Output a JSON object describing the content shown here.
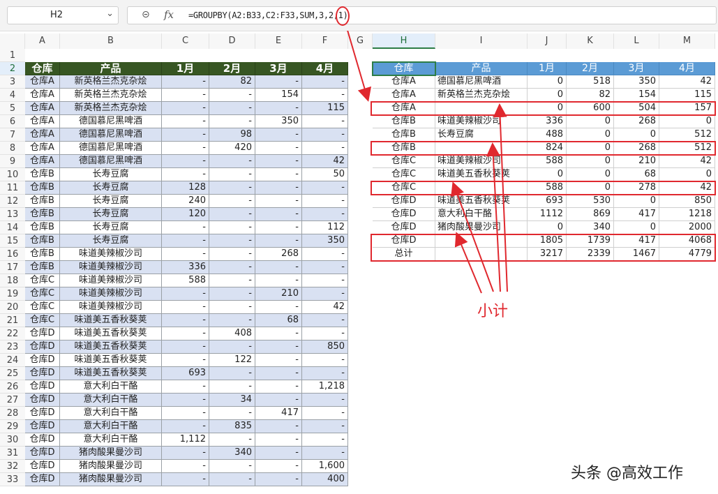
{
  "name_box": "H2",
  "formula_bar": {
    "zoom_icon": "zoom-icon",
    "fx_label": "fx",
    "formula": "=GROUPBY(A2:B33,C2:F33,SUM,3,2,1)"
  },
  "columns": [
    "A",
    "B",
    "C",
    "D",
    "E",
    "F",
    "G",
    "H",
    "I",
    "J",
    "K",
    "L",
    "M"
  ],
  "rows": [
    "1",
    "2",
    "3",
    "4",
    "5",
    "6",
    "7",
    "8",
    "9",
    "10",
    "11",
    "12",
    "13",
    "14",
    "15",
    "16",
    "17",
    "18",
    "19",
    "20",
    "21",
    "22",
    "23",
    "24",
    "25",
    "26",
    "27",
    "28",
    "29",
    "30",
    "31",
    "32",
    "33"
  ],
  "source_table": {
    "headers": [
      "仓库",
      "产品",
      "1月",
      "2月",
      "3月",
      "4月"
    ],
    "rows": [
      [
        "仓库A",
        "新英格兰杰克杂烩",
        "-",
        "82",
        "-",
        "-"
      ],
      [
        "仓库A",
        "新英格兰杰克杂烩",
        "-",
        "-",
        "154",
        "-"
      ],
      [
        "仓库A",
        "新英格兰杰克杂烩",
        "-",
        "-",
        "-",
        "115"
      ],
      [
        "仓库A",
        "德国慕尼黑啤酒",
        "-",
        "-",
        "350",
        "-"
      ],
      [
        "仓库A",
        "德国慕尼黑啤酒",
        "-",
        "98",
        "-",
        "-"
      ],
      [
        "仓库A",
        "德国慕尼黑啤酒",
        "-",
        "420",
        "-",
        "-"
      ],
      [
        "仓库A",
        "德国慕尼黑啤酒",
        "-",
        "-",
        "-",
        "42"
      ],
      [
        "仓库B",
        "长寿豆腐",
        "-",
        "-",
        "-",
        "50"
      ],
      [
        "仓库B",
        "长寿豆腐",
        "128",
        "-",
        "-",
        "-"
      ],
      [
        "仓库B",
        "长寿豆腐",
        "240",
        "-",
        "-",
        "-"
      ],
      [
        "仓库B",
        "长寿豆腐",
        "120",
        "-",
        "-",
        "-"
      ],
      [
        "仓库B",
        "长寿豆腐",
        "-",
        "-",
        "-",
        "112"
      ],
      [
        "仓库B",
        "长寿豆腐",
        "-",
        "-",
        "-",
        "350"
      ],
      [
        "仓库B",
        "味道美辣椒沙司",
        "-",
        "-",
        "268",
        "-"
      ],
      [
        "仓库B",
        "味道美辣椒沙司",
        "336",
        "-",
        "-",
        "-"
      ],
      [
        "仓库C",
        "味道美辣椒沙司",
        "588",
        "-",
        "-",
        "-"
      ],
      [
        "仓库C",
        "味道美辣椒沙司",
        "-",
        "-",
        "210",
        "-"
      ],
      [
        "仓库C",
        "味道美辣椒沙司",
        "-",
        "-",
        "-",
        "42"
      ],
      [
        "仓库C",
        "味道美五香秋葵荚",
        "-",
        "-",
        "68",
        "-"
      ],
      [
        "仓库D",
        "味道美五香秋葵荚",
        "-",
        "408",
        "-",
        "-"
      ],
      [
        "仓库D",
        "味道美五香秋葵荚",
        "-",
        "-",
        "-",
        "850"
      ],
      [
        "仓库D",
        "味道美五香秋葵荚",
        "-",
        "122",
        "-",
        "-"
      ],
      [
        "仓库D",
        "味道美五香秋葵荚",
        "693",
        "-",
        "-",
        "-"
      ],
      [
        "仓库D",
        "意大利白干酪",
        "-",
        "-",
        "-",
        "1,218"
      ],
      [
        "仓库D",
        "意大利白干酪",
        "-",
        "34",
        "-",
        "-"
      ],
      [
        "仓库D",
        "意大利白干酪",
        "-",
        "-",
        "417",
        "-"
      ],
      [
        "仓库D",
        "意大利白干酪",
        "-",
        "835",
        "-",
        "-"
      ],
      [
        "仓库D",
        "意大利白干酪",
        "1,112",
        "-",
        "-",
        "-"
      ],
      [
        "仓库D",
        "猪肉酸果曼沙司",
        "-",
        "340",
        "-",
        "-"
      ],
      [
        "仓库D",
        "猪肉酸果曼沙司",
        "-",
        "-",
        "-",
        "1,600"
      ],
      [
        "仓库D",
        "猪肉酸果曼沙司",
        "-",
        "-",
        "-",
        "400"
      ]
    ]
  },
  "result_table": {
    "headers": [
      "仓库",
      "产品",
      "1月",
      "2月",
      "3月",
      "4月"
    ],
    "rows": [
      [
        "仓库A",
        "德国慕尼黑啤酒",
        "0",
        "518",
        "350",
        "42"
      ],
      [
        "仓库A",
        "新英格兰杰克杂烩",
        "0",
        "82",
        "154",
        "115"
      ],
      [
        "仓库A",
        "",
        "0",
        "600",
        "504",
        "157"
      ],
      [
        "仓库B",
        "味道美辣椒沙司",
        "336",
        "0",
        "268",
        "0"
      ],
      [
        "仓库B",
        "长寿豆腐",
        "488",
        "0",
        "0",
        "512"
      ],
      [
        "仓库B",
        "",
        "824",
        "0",
        "268",
        "512"
      ],
      [
        "仓库C",
        "味道美辣椒沙司",
        "588",
        "0",
        "210",
        "42"
      ],
      [
        "仓库C",
        "味道美五香秋葵荚",
        "0",
        "0",
        "68",
        "0"
      ],
      [
        "仓库C",
        "",
        "588",
        "0",
        "278",
        "42"
      ],
      [
        "仓库D",
        "味道美五香秋葵荚",
        "693",
        "530",
        "0",
        "850"
      ],
      [
        "仓库D",
        "意大利白干酪",
        "1112",
        "869",
        "417",
        "1218"
      ],
      [
        "仓库D",
        "猪肉酸果曼沙司",
        "0",
        "340",
        "0",
        "2000"
      ],
      [
        "仓库D",
        "",
        "1805",
        "1739",
        "417",
        "4068"
      ],
      [
        "总计",
        "",
        "3217",
        "2339",
        "1467",
        "4779"
      ]
    ]
  },
  "callout_label": "小计",
  "watermark": "头条 @高效工作",
  "colors": {
    "left_header": "#375623",
    "band": "#d9e1f2",
    "right_header": "#5b9bd5",
    "annotation_red": "#e0282e",
    "selection_green": "#2d7d46"
  }
}
